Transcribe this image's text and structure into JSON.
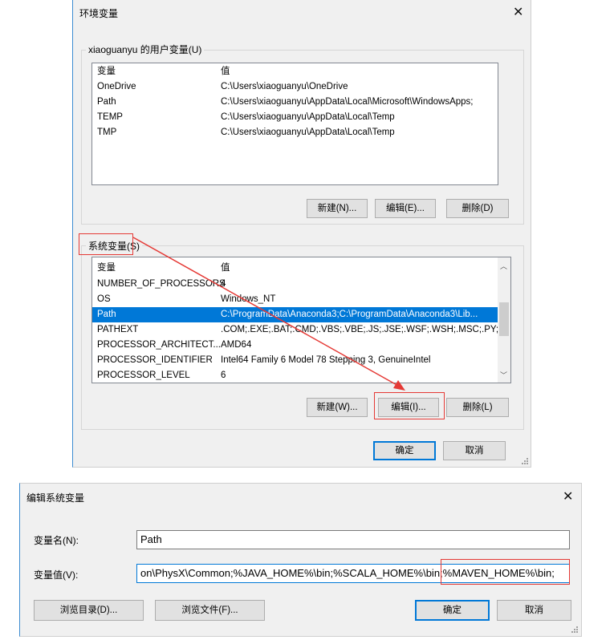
{
  "env_dialog": {
    "title": "环境变量",
    "user_group_label": "xiaoguanyu 的用户变量(U)",
    "user_table": {
      "headers": [
        "变量",
        "值"
      ],
      "rows": [
        {
          "name": "OneDrive",
          "value": "C:\\Users\\xiaoguanyu\\OneDrive"
        },
        {
          "name": "Path",
          "value": "C:\\Users\\xiaoguanyu\\AppData\\Local\\Microsoft\\WindowsApps;"
        },
        {
          "name": "TEMP",
          "value": "C:\\Users\\xiaoguanyu\\AppData\\Local\\Temp"
        },
        {
          "name": "TMP",
          "value": "C:\\Users\\xiaoguanyu\\AppData\\Local\\Temp"
        }
      ]
    },
    "user_buttons": {
      "new": "新建(N)...",
      "edit": "编辑(E)...",
      "delete": "删除(D)"
    },
    "system_group_label": "系统变量(S)",
    "system_table": {
      "headers": [
        "变量",
        "值"
      ],
      "rows": [
        {
          "name": "NUMBER_OF_PROCESSORS",
          "value": "4"
        },
        {
          "name": "OS",
          "value": "Windows_NT"
        },
        {
          "name": "Path",
          "value": "C:\\ProgramData\\Anaconda3;C:\\ProgramData\\Anaconda3\\Lib...",
          "selected": true
        },
        {
          "name": "PATHEXT",
          "value": ".COM;.EXE;.BAT;.CMD;.VBS;.VBE;.JS;.JSE;.WSF;.WSH;.MSC;.PY;.P..."
        },
        {
          "name": "PROCESSOR_ARCHITECT...",
          "value": "AMD64"
        },
        {
          "name": "PROCESSOR_IDENTIFIER",
          "value": "Intel64 Family 6 Model 78 Stepping 3, GenuineIntel"
        },
        {
          "name": "PROCESSOR_LEVEL",
          "value": "6"
        }
      ]
    },
    "system_buttons": {
      "new": "新建(W)...",
      "edit": "编辑(I)...",
      "delete": "删除(L)"
    },
    "ok": "确定",
    "cancel": "取消"
  },
  "edit_dialog": {
    "title": "编辑系统变量",
    "name_label": "变量名(N):",
    "name_value": "Path",
    "value_label": "变量值(V):",
    "value_text": "on\\PhysX\\Common;%JAVA_HOME%\\bin;%SCALA_HOME%\\bin;%MAVEN_HOME%\\bin;",
    "browse_dir": "浏览目录(D)...",
    "browse_file": "浏览文件(F)...",
    "ok": "确定",
    "cancel": "取消"
  },
  "colors": {
    "selection": "#0078d7",
    "annotation": "#e53935"
  }
}
